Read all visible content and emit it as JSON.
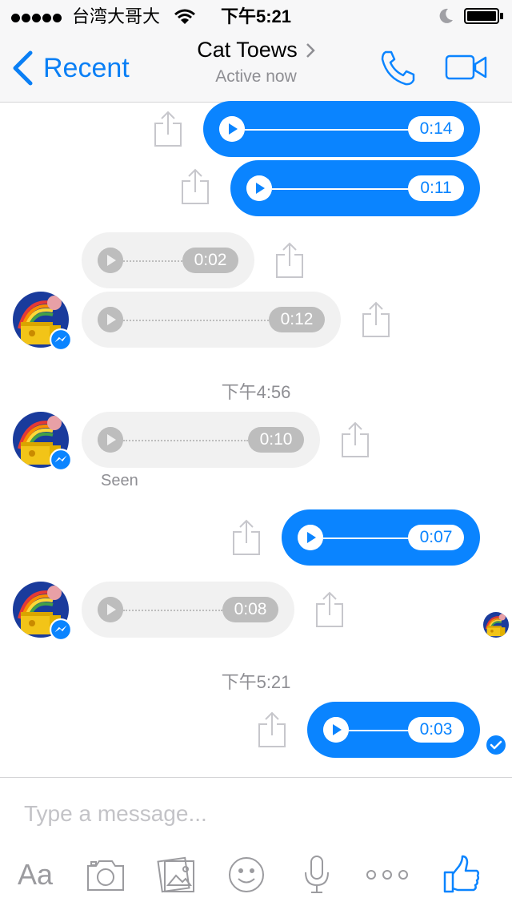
{
  "status_bar": {
    "carrier": "台湾大哥大",
    "time": "下午5:21"
  },
  "nav": {
    "back_label": "Recent",
    "contact_name": "Cat Toews",
    "status": "Active now"
  },
  "messages": [
    {
      "dir": "out",
      "duration": "0:14"
    },
    {
      "dir": "out",
      "duration": "0:11"
    },
    {
      "dir": "in",
      "duration": "0:02"
    },
    {
      "dir": "in",
      "duration": "0:12"
    },
    {
      "dir": "in",
      "duration": "0:10"
    },
    {
      "dir": "out",
      "duration": "0:07"
    },
    {
      "dir": "in",
      "duration": "0:08"
    },
    {
      "dir": "out",
      "duration": "0:03"
    }
  ],
  "timestamps": [
    "下午4:56",
    "下午5:21"
  ],
  "seen_label": "Seen",
  "composer": {
    "placeholder": "Type a message...",
    "text_tool_label": "Aa"
  },
  "colors": {
    "accent": "#0a84ff",
    "incoming_bubble": "#f1f1f1",
    "incoming_control": "#bdbdbd",
    "muted_text": "#8e8e93"
  },
  "icons": [
    "back-chevron-icon",
    "disclosure-chevron-icon",
    "phone-icon",
    "video-camera-icon",
    "play-icon",
    "share-icon",
    "messenger-badge-icon",
    "camera-icon",
    "photo-library-icon",
    "emoji-icon",
    "microphone-icon",
    "more-icon",
    "thumbs-up-icon"
  ]
}
